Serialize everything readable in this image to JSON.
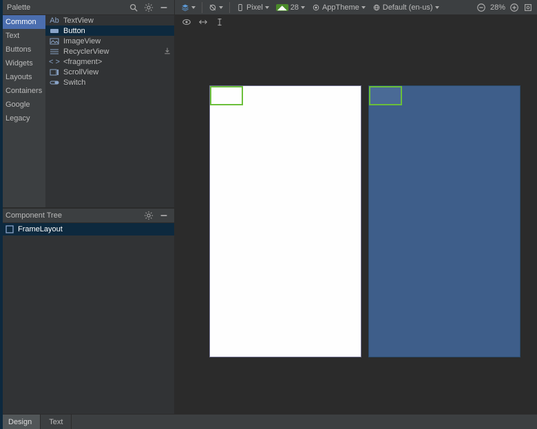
{
  "palette": {
    "title": "Palette",
    "categories": [
      "Common",
      "Text",
      "Buttons",
      "Widgets",
      "Layouts",
      "Containers",
      "Google",
      "Legacy"
    ],
    "selected_category": 0,
    "items": [
      {
        "icon": "textview-icon",
        "label": "TextView"
      },
      {
        "icon": "button-icon",
        "label": "Button"
      },
      {
        "icon": "imageview-icon",
        "label": "ImageView"
      },
      {
        "icon": "recyclerview-icon",
        "label": "RecyclerView"
      },
      {
        "icon": "fragment-icon",
        "label": "<fragment>"
      },
      {
        "icon": "scrollview-icon",
        "label": "ScrollView"
      },
      {
        "icon": "switch-icon",
        "label": "Switch"
      }
    ],
    "selected_item": 1
  },
  "component_tree": {
    "title": "Component Tree",
    "root": {
      "icon": "framelayout-icon",
      "label": "FrameLayout"
    }
  },
  "toolbar": {
    "device_label": "Pixel",
    "api_label": "28",
    "theme_label": "AppTheme",
    "locale_label": "Default (en-us)",
    "zoom_label": "28%"
  },
  "bottom_tabs": {
    "design": "Design",
    "text": "Text",
    "active": 0
  }
}
